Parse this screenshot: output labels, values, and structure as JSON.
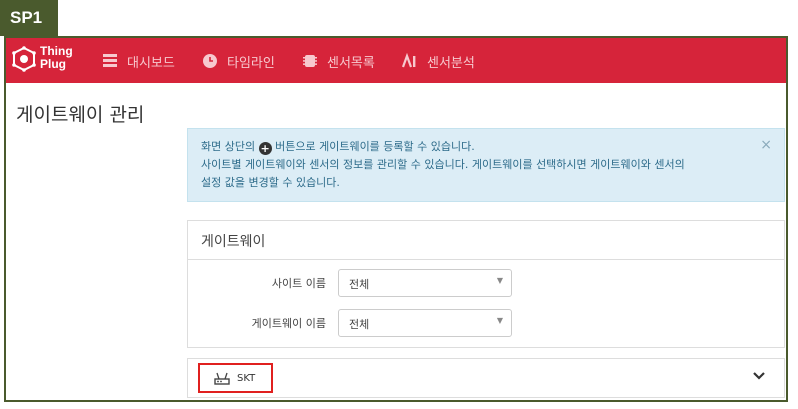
{
  "annotation": {
    "label": "SP1"
  },
  "app": {
    "logo_line1": "Thing",
    "logo_line2": "Plug"
  },
  "nav": [
    {
      "label": "대시보드",
      "icon": "dashboard-icon"
    },
    {
      "label": "타임라인",
      "icon": "clock-icon"
    },
    {
      "label": "센서목록",
      "icon": "chip-icon"
    },
    {
      "label": "센서분석",
      "icon": "analysis-icon"
    }
  ],
  "page": {
    "title": "게이트웨이 관리"
  },
  "alert": {
    "line1_before": "화면 상단의",
    "line1_after": "버튼으로 게이트웨이를 등록할 수 있습니다.",
    "line2": "사이트별 게이트웨이와 센서의 정보를 관리할 수 있습니다. 게이트웨이를 선택하시면 게이트웨이와 센서의",
    "line3": "설정 값을 변경할 수 있습니다.",
    "close": "×"
  },
  "gateway_panel": {
    "title": "게이트웨이",
    "site_label": "사이트 이름",
    "site_value": "전체",
    "gateway_label": "게이트웨이 이름",
    "gateway_value": "전체"
  },
  "gateway_list": [
    {
      "name": "SKT"
    }
  ],
  "colors": {
    "navbar": "#d6243a",
    "annotation": "#4a5a2d",
    "highlight": "#e0201f",
    "alert_bg": "#dcedf6"
  }
}
